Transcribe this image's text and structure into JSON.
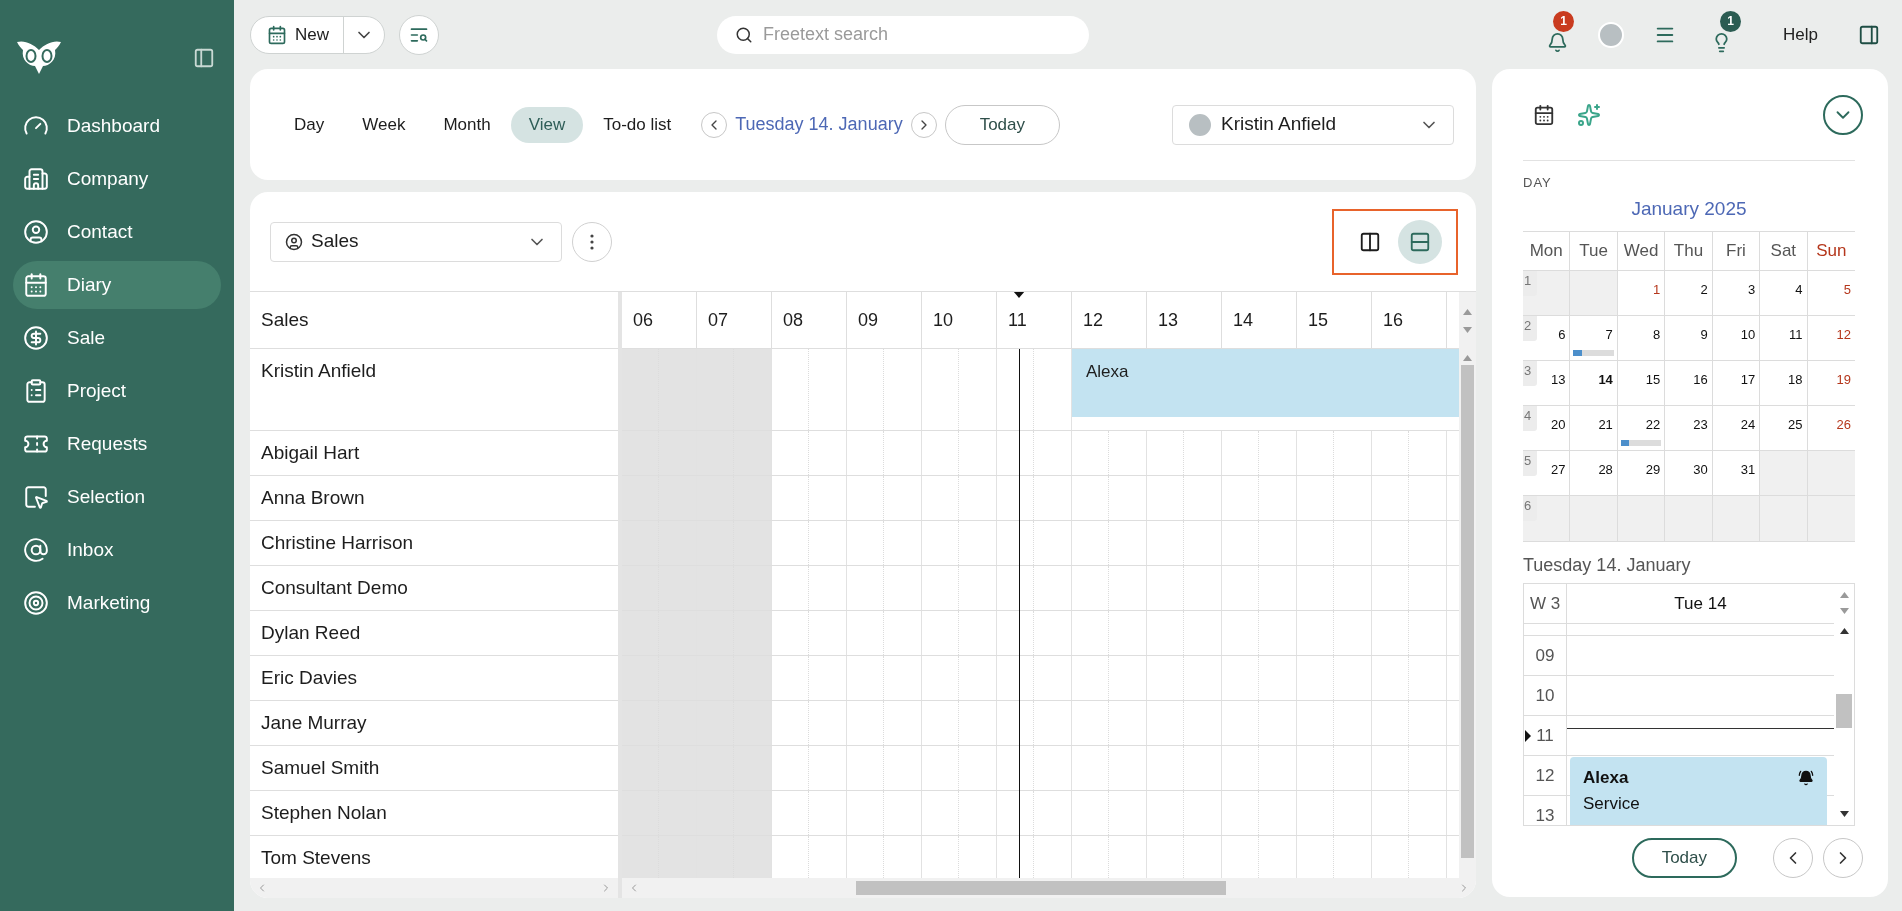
{
  "sidebar": {
    "items": [
      {
        "label": "Dashboard",
        "kind": "gauge",
        "selected": false
      },
      {
        "label": "Company",
        "kind": "building",
        "selected": false
      },
      {
        "label": "Contact",
        "kind": "person",
        "selected": false
      },
      {
        "label": "Diary",
        "kind": "calendar",
        "selected": true
      },
      {
        "label": "Sale",
        "kind": "dollar",
        "selected": false
      },
      {
        "label": "Project",
        "kind": "clipboard",
        "selected": false
      },
      {
        "label": "Requests",
        "kind": "ticket",
        "selected": false
      },
      {
        "label": "Selection",
        "kind": "selection",
        "selected": false
      },
      {
        "label": "Inbox",
        "kind": "at",
        "selected": false
      },
      {
        "label": "Marketing",
        "kind": "target",
        "selected": false
      }
    ]
  },
  "topbar": {
    "new_button": "New",
    "search": {
      "placeholder": "Freetext search"
    },
    "notifications_badge": "1",
    "tips_badge": "1",
    "help": "Help"
  },
  "toolbar": {
    "tabs": [
      {
        "label": "Day",
        "selected": false
      },
      {
        "label": "Week",
        "selected": false
      },
      {
        "label": "Month",
        "selected": false
      },
      {
        "label": "View",
        "selected": true
      },
      {
        "label": "To-do list",
        "selected": false
      }
    ],
    "date": "Tuesday 14. January",
    "today": "Today",
    "user": "Kristin Anfield"
  },
  "planner": {
    "group": "Sales",
    "layout_buttons": [
      {
        "kind": "columns",
        "selected": false
      },
      {
        "kind": "rows",
        "selected": true
      }
    ],
    "column_header": "Sales",
    "hours": [
      {
        "label": "06",
        "working": false,
        "current": false
      },
      {
        "label": "07",
        "working": false,
        "current": false
      },
      {
        "label": "08",
        "working": true,
        "current": false
      },
      {
        "label": "09",
        "working": true,
        "current": false
      },
      {
        "label": "10",
        "working": true,
        "current": false
      },
      {
        "label": "11",
        "working": true,
        "current": true
      },
      {
        "label": "12",
        "working": true,
        "current": false
      },
      {
        "label": "13",
        "working": true,
        "current": false
      },
      {
        "label": "14",
        "working": true,
        "current": false
      },
      {
        "label": "15",
        "working": true,
        "current": false
      },
      {
        "label": "16",
        "working": true,
        "current": false
      }
    ],
    "rows": [
      {
        "name": "Kristin Anfield",
        "event": {
          "title": "Alexa"
        },
        "slots": [
          {
            "busy": false
          },
          {
            "busy": false
          },
          {
            "busy": false
          },
          {
            "busy": false
          },
          {
            "busy": false
          },
          {
            "busy": false
          },
          {
            "busy": true
          },
          {
            "busy": true
          },
          {
            "busy": true
          },
          {
            "busy": true
          },
          {
            "busy": true
          }
        ]
      },
      {
        "name": "Abigail Hart"
      },
      {
        "name": "Anna Brown"
      },
      {
        "name": "Christine Harrison"
      },
      {
        "name": "Consultant Demo"
      },
      {
        "name": "Dylan Reed"
      },
      {
        "name": "Eric Davies"
      },
      {
        "name": "Jane Murray"
      },
      {
        "name": "Samuel Smith"
      },
      {
        "name": "Stephen Nolan"
      },
      {
        "name": "Tom Stevens"
      }
    ]
  },
  "side_panel": {
    "section_label": "DAY",
    "month": "January 2025",
    "weekdays": [
      {
        "label": "Mon",
        "kind": "weekday"
      },
      {
        "label": "Tue",
        "kind": "weekday"
      },
      {
        "label": "Wed",
        "kind": "weekday"
      },
      {
        "label": "Thu",
        "kind": "weekday"
      },
      {
        "label": "Fri",
        "kind": "weekday"
      },
      {
        "label": "Sat",
        "kind": "weekday"
      },
      {
        "label": "Sun",
        "kind": "sunday"
      }
    ],
    "weeks": [
      {
        "number": "1",
        "days": [
          {
            "kind": "blank"
          },
          {
            "kind": "blank"
          },
          {
            "label": "1",
            "kind": "holiday"
          },
          {
            "label": "2",
            "kind": "weekday"
          },
          {
            "label": "3",
            "kind": "weekday"
          },
          {
            "label": "4",
            "kind": "weekday"
          },
          {
            "label": "5",
            "kind": "sunday"
          }
        ]
      },
      {
        "number": "2",
        "days": [
          {
            "label": "6",
            "kind": "weekday"
          },
          {
            "label": "7",
            "kind": "weekday",
            "level": 0.2
          },
          {
            "label": "8",
            "kind": "weekday"
          },
          {
            "label": "9",
            "kind": "weekday"
          },
          {
            "label": "10",
            "kind": "weekday"
          },
          {
            "label": "11",
            "kind": "weekday"
          },
          {
            "label": "12",
            "kind": "sunday"
          }
        ]
      },
      {
        "number": "3",
        "days": [
          {
            "label": "13",
            "kind": "weekday"
          },
          {
            "label": "14",
            "kind": "today"
          },
          {
            "label": "15",
            "kind": "weekday"
          },
          {
            "label": "16",
            "kind": "weekday"
          },
          {
            "label": "17",
            "kind": "weekday"
          },
          {
            "label": "18",
            "kind": "weekday"
          },
          {
            "label": "19",
            "kind": "sunday"
          }
        ]
      },
      {
        "number": "4",
        "days": [
          {
            "label": "20",
            "kind": "weekday"
          },
          {
            "label": "21",
            "kind": "weekday"
          },
          {
            "label": "22",
            "kind": "weekday",
            "level": 0.2
          },
          {
            "label": "23",
            "kind": "weekday"
          },
          {
            "label": "24",
            "kind": "weekday"
          },
          {
            "label": "25",
            "kind": "weekday"
          },
          {
            "label": "26",
            "kind": "sunday"
          }
        ]
      },
      {
        "number": "5",
        "days": [
          {
            "label": "27",
            "kind": "weekday"
          },
          {
            "label": "28",
            "kind": "weekday"
          },
          {
            "label": "29",
            "kind": "weekday"
          },
          {
            "label": "30",
            "kind": "weekday"
          },
          {
            "label": "31",
            "kind": "weekday"
          },
          {
            "kind": "blank"
          },
          {
            "kind": "blank"
          }
        ]
      },
      {
        "number": "6",
        "days": [
          {
            "kind": "blank"
          },
          {
            "kind": "blank"
          },
          {
            "kind": "blank"
          },
          {
            "kind": "blank"
          },
          {
            "kind": "blank"
          },
          {
            "kind": "blank"
          },
          {
            "kind": "blank"
          }
        ]
      }
    ],
    "day_title": "Tuesday 14. January",
    "week_label": "W 3",
    "day_column": "Tue 14",
    "hours": [
      {
        "label": "09",
        "current": false
      },
      {
        "label": "10",
        "current": false
      },
      {
        "label": "11",
        "current": true
      },
      {
        "label": "12",
        "current": false,
        "event": {
          "title": "Alexa",
          "subtitle": "Service",
          "reminder": true
        }
      },
      {
        "label": "13",
        "current": false
      }
    ],
    "today": "Today"
  }
}
